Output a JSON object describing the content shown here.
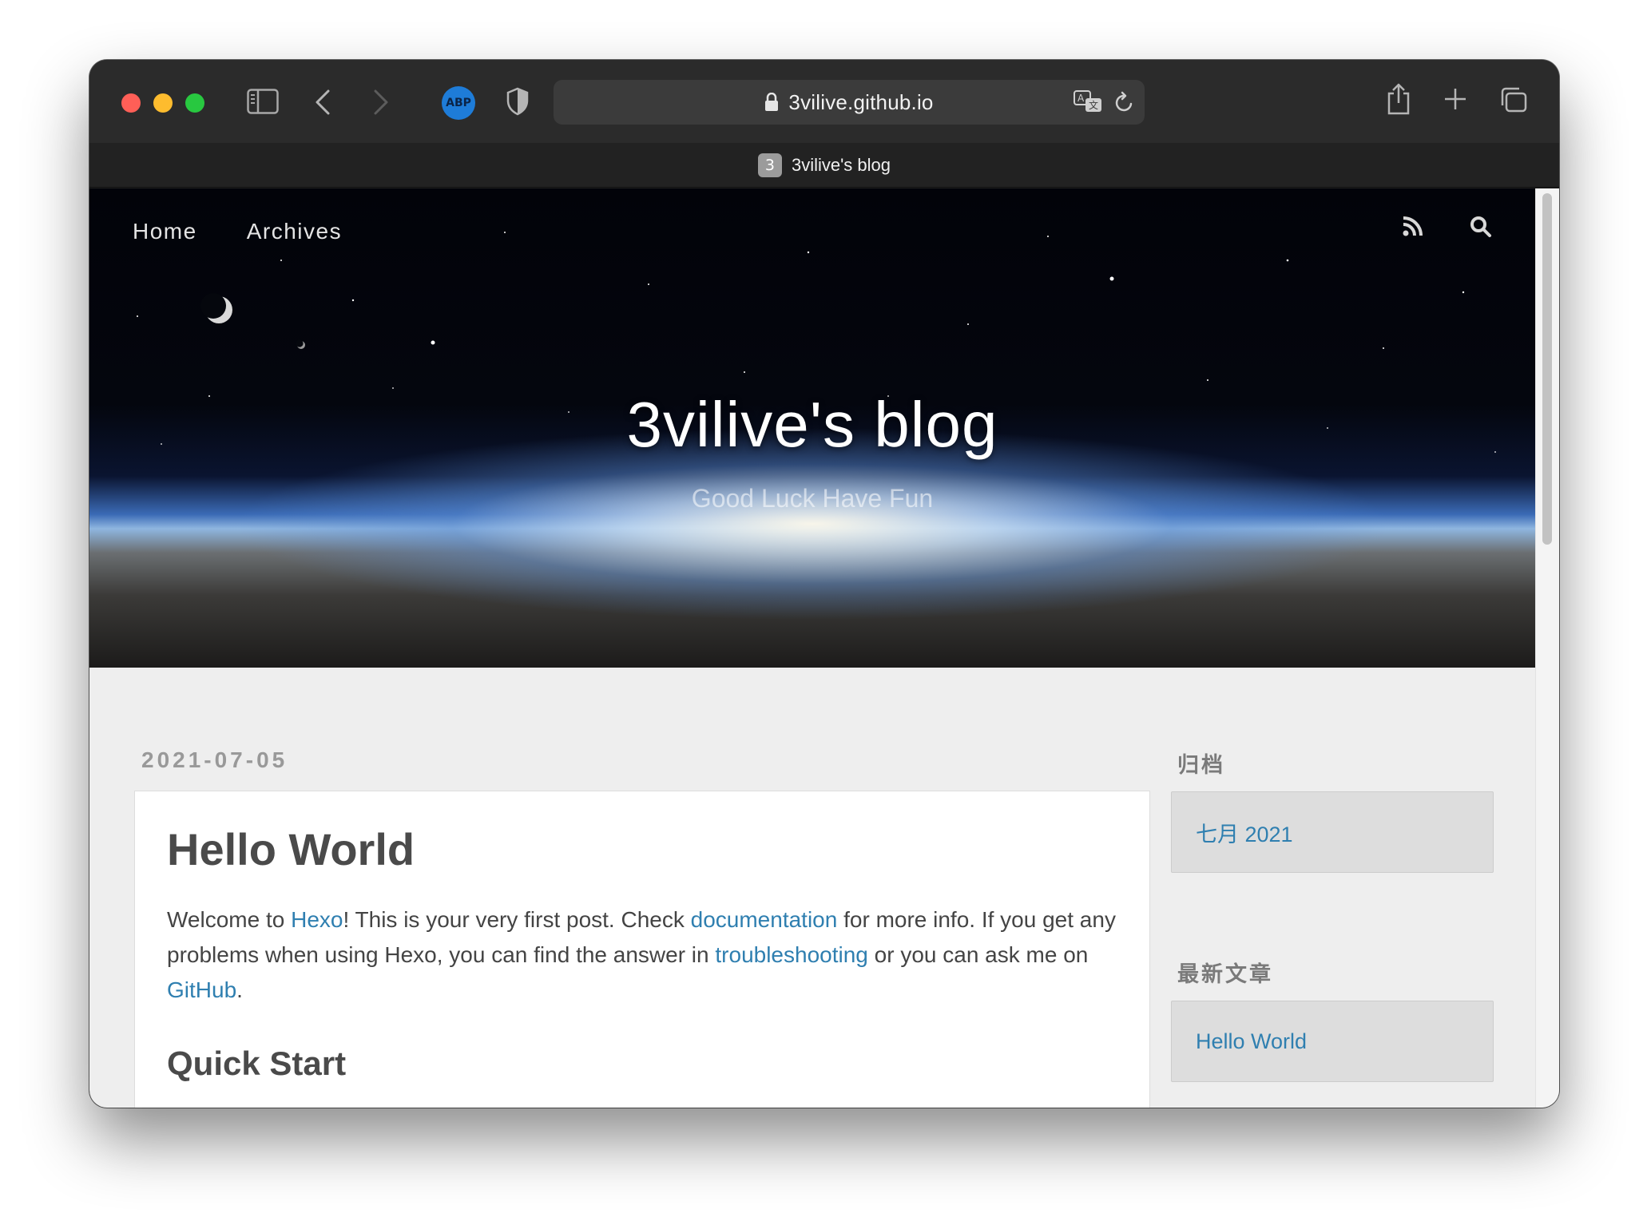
{
  "browser": {
    "url": "3vilive.github.io",
    "tab": {
      "favicon_text": "3",
      "title": "3vilive's blog"
    },
    "extension_abp_label": "ABP",
    "icons": [
      "sidebar-icon",
      "back-icon",
      "forward-icon",
      "shield-icon",
      "lock-icon",
      "translate-icon",
      "reload-icon",
      "share-icon",
      "new-tab-icon",
      "tab-overview-icon"
    ]
  },
  "site": {
    "nav": {
      "home": "Home",
      "archives": "Archives"
    },
    "title": "3vilive's blog",
    "subtitle": "Good Luck Have Fun"
  },
  "post": {
    "date": "2021-07-05",
    "title": "Hello World",
    "paragraph": {
      "t1": "Welcome to ",
      "link_hexo": "Hexo",
      "t2": "! This is your very first post. Check ",
      "link_docs": "documentation",
      "t3": " for more info. If you get any problems when using Hexo, you can find the answer in ",
      "link_troubleshooting": "troubleshooting",
      "t4": " or you can ask me on ",
      "link_github": "GitHub",
      "t5": "."
    },
    "section_heading": "Quick Start"
  },
  "sidebar": {
    "archive_title": "归档",
    "archive_item": "七月 2021",
    "recent_title": "最新文章",
    "recent_item": "Hello World"
  },
  "colors": {
    "link": "#2f7fb0",
    "traffic_red": "#ff5f57",
    "traffic_yellow": "#febc2e",
    "traffic_green": "#28c840"
  }
}
